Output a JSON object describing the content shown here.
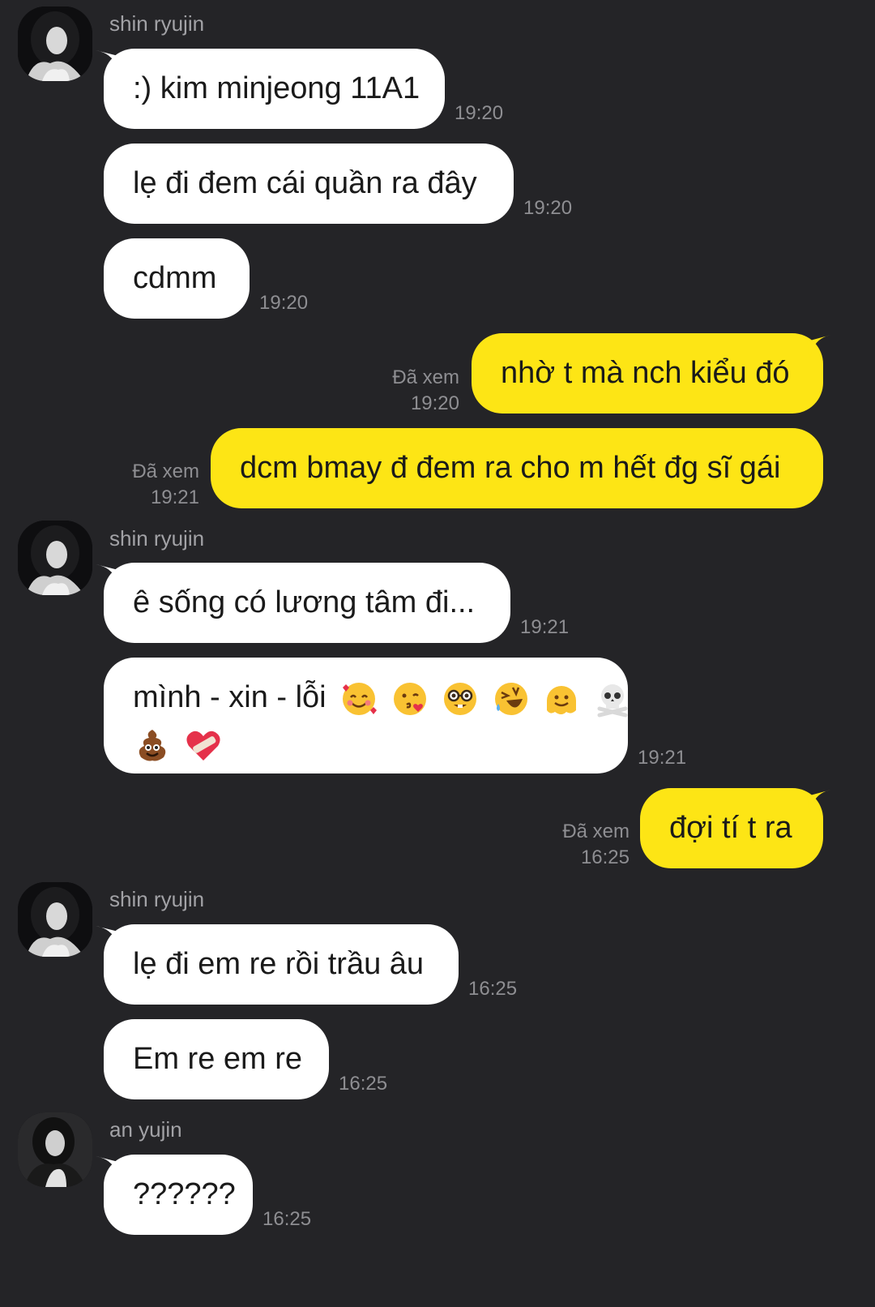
{
  "colors": {
    "background": "#242427",
    "incoming_bubble": "#ffffff",
    "outgoing_bubble": "#fde515",
    "meta_text": "#8e8e92"
  },
  "messages": [
    {
      "sender": "shin ryujin",
      "text": ":) kim minjeong 11A1",
      "time": "19:20"
    },
    {
      "text": "lẹ đi đem cái quần ra đây",
      "time": "19:20"
    },
    {
      "text": "cdmm",
      "time": "19:20"
    },
    {
      "outgoing": true,
      "text": "nhờ t mà nch kiểu đó",
      "read": "Đã xem",
      "time": "19:20"
    },
    {
      "outgoing": true,
      "text": "dcm bmay đ đem ra cho m hết đg sĩ gái",
      "read": "Đã xem",
      "time": "19:21"
    },
    {
      "sender": "shin ryujin",
      "text": "ê sống có lương tâm đi...",
      "time": "19:21"
    },
    {
      "text": "mình - xin - lỗi",
      "emojis_line1": [
        "smiling-face-with-hearts",
        "face-blowing-kiss",
        "nerd-face",
        "rolling-laughing-face",
        "melting-face",
        "skull-and-crossbones"
      ],
      "emojis_line2": [
        "pile-of-poo",
        "mending-heart"
      ],
      "time": "19:21"
    },
    {
      "outgoing": true,
      "text": "đợi tí t ra",
      "read": "Đã xem",
      "time": "16:25"
    },
    {
      "sender": "shin ryujin",
      "text": "lẹ đi em re rồi trầu âu",
      "time": "16:25"
    },
    {
      "text": "Em re em re",
      "time": "16:25"
    },
    {
      "sender": "an yujin",
      "text": "??????",
      "time": "16:25"
    }
  ]
}
